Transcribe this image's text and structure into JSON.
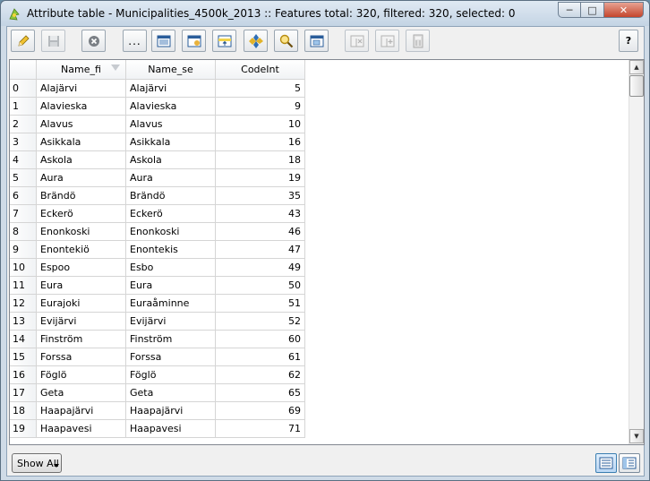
{
  "window": {
    "title": "Attribute table - Municipalities_4500k_2013 :: Features total: 320, filtered: 320, selected: 0",
    "controls": {
      "minimize": "─",
      "maximize": "□",
      "close": "✕"
    }
  },
  "toolbar": {
    "buttons": [
      {
        "name": "toggle-editing",
        "icon": "pencil-icon"
      },
      {
        "name": "save-edits",
        "icon": "save-icon"
      },
      {
        "name": "delete-selected",
        "icon": "delete-icon"
      },
      {
        "name": "expression-select",
        "icon": "ellipsis-icon",
        "label": "..."
      },
      {
        "name": "select-all",
        "icon": "select-all-icon"
      },
      {
        "name": "invert-selection",
        "icon": "invert-selection-icon"
      },
      {
        "name": "move-selection-to-top",
        "icon": "move-selected-top-icon"
      },
      {
        "name": "pan-to-selected",
        "icon": "pan-map-icon"
      },
      {
        "name": "zoom-to-selected",
        "icon": "zoom-icon"
      },
      {
        "name": "copy-selected",
        "icon": "copy-rows-icon"
      },
      {
        "name": "delete-column",
        "icon": "delete-column-icon"
      },
      {
        "name": "new-column",
        "icon": "new-column-icon"
      },
      {
        "name": "field-calculator",
        "icon": "calculator-icon"
      }
    ],
    "help_label": "?"
  },
  "table": {
    "columns": [
      "Name_fi",
      "Name_se",
      "CodeInt"
    ],
    "rows": [
      {
        "id": "0",
        "name_fi": "Alajärvi",
        "name_se": "Alajärvi",
        "code": "5"
      },
      {
        "id": "1",
        "name_fi": "Alavieska",
        "name_se": "Alavieska",
        "code": "9"
      },
      {
        "id": "2",
        "name_fi": "Alavus",
        "name_se": "Alavus",
        "code": "10"
      },
      {
        "id": "3",
        "name_fi": "Asikkala",
        "name_se": "Asikkala",
        "code": "16"
      },
      {
        "id": "4",
        "name_fi": "Askola",
        "name_se": "Askola",
        "code": "18"
      },
      {
        "id": "5",
        "name_fi": "Aura",
        "name_se": "Aura",
        "code": "19"
      },
      {
        "id": "6",
        "name_fi": "Brändö",
        "name_se": "Brändö",
        "code": "35"
      },
      {
        "id": "7",
        "name_fi": "Eckerö",
        "name_se": "Eckerö",
        "code": "43"
      },
      {
        "id": "8",
        "name_fi": "Enonkoski",
        "name_se": "Enonkoski",
        "code": "46"
      },
      {
        "id": "9",
        "name_fi": "Enontekiö",
        "name_se": "Enontekis",
        "code": "47"
      },
      {
        "id": "10",
        "name_fi": "Espoo",
        "name_se": "Esbo",
        "code": "49"
      },
      {
        "id": "11",
        "name_fi": "Eura",
        "name_se": "Eura",
        "code": "50"
      },
      {
        "id": "12",
        "name_fi": "Eurajoki",
        "name_se": "Euraåminne",
        "code": "51"
      },
      {
        "id": "13",
        "name_fi": "Evijärvi",
        "name_se": "Evijärvi",
        "code": "52"
      },
      {
        "id": "14",
        "name_fi": "Finström",
        "name_se": "Finström",
        "code": "60"
      },
      {
        "id": "15",
        "name_fi": "Forssa",
        "name_se": "Forssa",
        "code": "61"
      },
      {
        "id": "16",
        "name_fi": "Föglö",
        "name_se": "Föglö",
        "code": "62"
      },
      {
        "id": "17",
        "name_fi": "Geta",
        "name_se": "Geta",
        "code": "65"
      },
      {
        "id": "18",
        "name_fi": "Haapajärvi",
        "name_se": "Haapajärvi",
        "code": "69"
      },
      {
        "id": "19",
        "name_fi": "Haapavesi",
        "name_se": "Haapavesi",
        "code": "71"
      }
    ]
  },
  "footer": {
    "show_all_label": "Show All"
  }
}
